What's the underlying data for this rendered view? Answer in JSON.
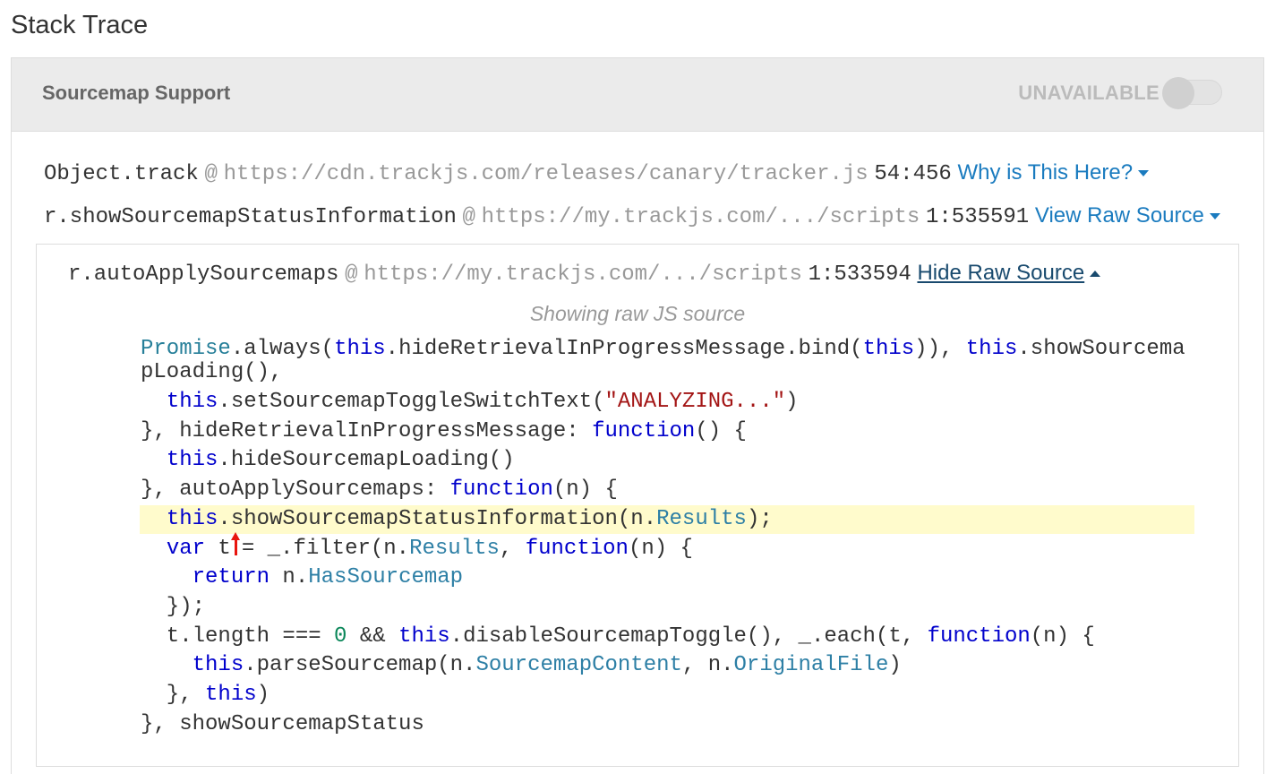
{
  "page": {
    "title": "Stack Trace"
  },
  "sourcemap": {
    "label": "Sourcemap Support",
    "status": "UNAVAILABLE",
    "enabled": false
  },
  "frames": [
    {
      "function": "Object.track",
      "at": "@",
      "url": "https://cdn.trackjs.com/releases/canary/tracker.js",
      "position": "54:456",
      "link": "Why is This Here?"
    },
    {
      "function": "r.showSourcemapStatusInformation",
      "at": "@",
      "url": "https://my.trackjs.com/.../scripts",
      "position": "1:535591",
      "link": "View Raw Source"
    },
    {
      "function": "r.autoApplySourcemaps",
      "at": "@",
      "url": "https://my.trackjs.com/.../scripts",
      "position": "1:533594",
      "link": "Hide Raw Source"
    }
  ],
  "source": {
    "note": "Showing raw JS source",
    "lines": [
      {
        "tokens": [
          [
            "cls",
            "Promise"
          ],
          [
            "p",
            "."
          ],
          [
            "p",
            "always("
          ],
          [
            "kw",
            "this"
          ],
          [
            "p",
            ".hideRetrievalInProgressMessage.bind("
          ],
          [
            "kw",
            "this"
          ],
          [
            "p",
            ")), "
          ],
          [
            "kw",
            "this"
          ],
          [
            "p",
            ".showSourcema"
          ]
        ],
        "cls": "wrap1"
      },
      {
        "tokens": [
          [
            "p",
            "pLoading(),"
          ]
        ],
        "cls": "wrap2"
      },
      {
        "tokens": [
          [
            "p",
            "  "
          ],
          [
            "kw",
            "this"
          ],
          [
            "p",
            ".setSourcemapToggleSwitchText("
          ],
          [
            "str",
            "\"ANALYZING...\""
          ],
          [
            "p",
            ")"
          ]
        ]
      },
      {
        "tokens": [
          [
            "p",
            "}, hideRetrievalInProgressMessage: "
          ],
          [
            "kw",
            "function"
          ],
          [
            "p",
            "() {"
          ]
        ]
      },
      {
        "tokens": [
          [
            "p",
            "  "
          ],
          [
            "kw",
            "this"
          ],
          [
            "p",
            ".hideSourcemapLoading()"
          ]
        ]
      },
      {
        "tokens": [
          [
            "p",
            "}, autoApplySourcemaps: "
          ],
          [
            "kw",
            "function"
          ],
          [
            "p",
            "(n) {"
          ]
        ]
      },
      {
        "tokens": [
          [
            "p",
            "  "
          ],
          [
            "kw",
            "this"
          ],
          [
            "p",
            ".showSourcemapStatusInformation(n."
          ],
          [
            "prop",
            "Results"
          ],
          [
            "p",
            ");"
          ]
        ],
        "highlight": true
      },
      {
        "tokens": [
          [
            "p",
            "  "
          ],
          [
            "kw",
            "var"
          ],
          [
            "p",
            " t"
          ],
          [
            "arrow",
            ""
          ],
          [
            "p",
            "= _.filter(n."
          ],
          [
            "prop",
            "Results"
          ],
          [
            "p",
            ", "
          ],
          [
            "kw",
            "function"
          ],
          [
            "p",
            "(n) {"
          ]
        ]
      },
      {
        "tokens": [
          [
            "p",
            "    "
          ],
          [
            "kw",
            "return"
          ],
          [
            "p",
            " n."
          ],
          [
            "prop",
            "HasSourcemap"
          ]
        ]
      },
      {
        "tokens": [
          [
            "p",
            "  });"
          ]
        ]
      },
      {
        "tokens": [
          [
            "p",
            "  t.length === "
          ],
          [
            "num",
            "0"
          ],
          [
            "p",
            " && "
          ],
          [
            "kw",
            "this"
          ],
          [
            "p",
            ".disableSourcemapToggle(), _.each(t, "
          ],
          [
            "kw",
            "function"
          ],
          [
            "p",
            "(n) {"
          ]
        ]
      },
      {
        "tokens": [
          [
            "p",
            "    "
          ],
          [
            "kw",
            "this"
          ],
          [
            "p",
            ".parseSourcemap(n."
          ],
          [
            "prop",
            "SourcemapContent"
          ],
          [
            "p",
            ", n."
          ],
          [
            "prop",
            "OriginalFile"
          ],
          [
            "p",
            ")"
          ]
        ]
      },
      {
        "tokens": [
          [
            "p",
            "  }, "
          ],
          [
            "kw",
            "this"
          ],
          [
            "p",
            ")"
          ]
        ]
      },
      {
        "tokens": [
          [
            "p",
            "}, showSourcemapStatus"
          ]
        ]
      }
    ]
  },
  "colors": {
    "link": "#1a7bbf",
    "link_active": "#194a6e",
    "keyword": "#0000cc",
    "property": "#2d7fa5",
    "string": "#a31515",
    "number": "#098658",
    "highlight": "#fffbcc",
    "error_arrow": "#e8150e"
  }
}
